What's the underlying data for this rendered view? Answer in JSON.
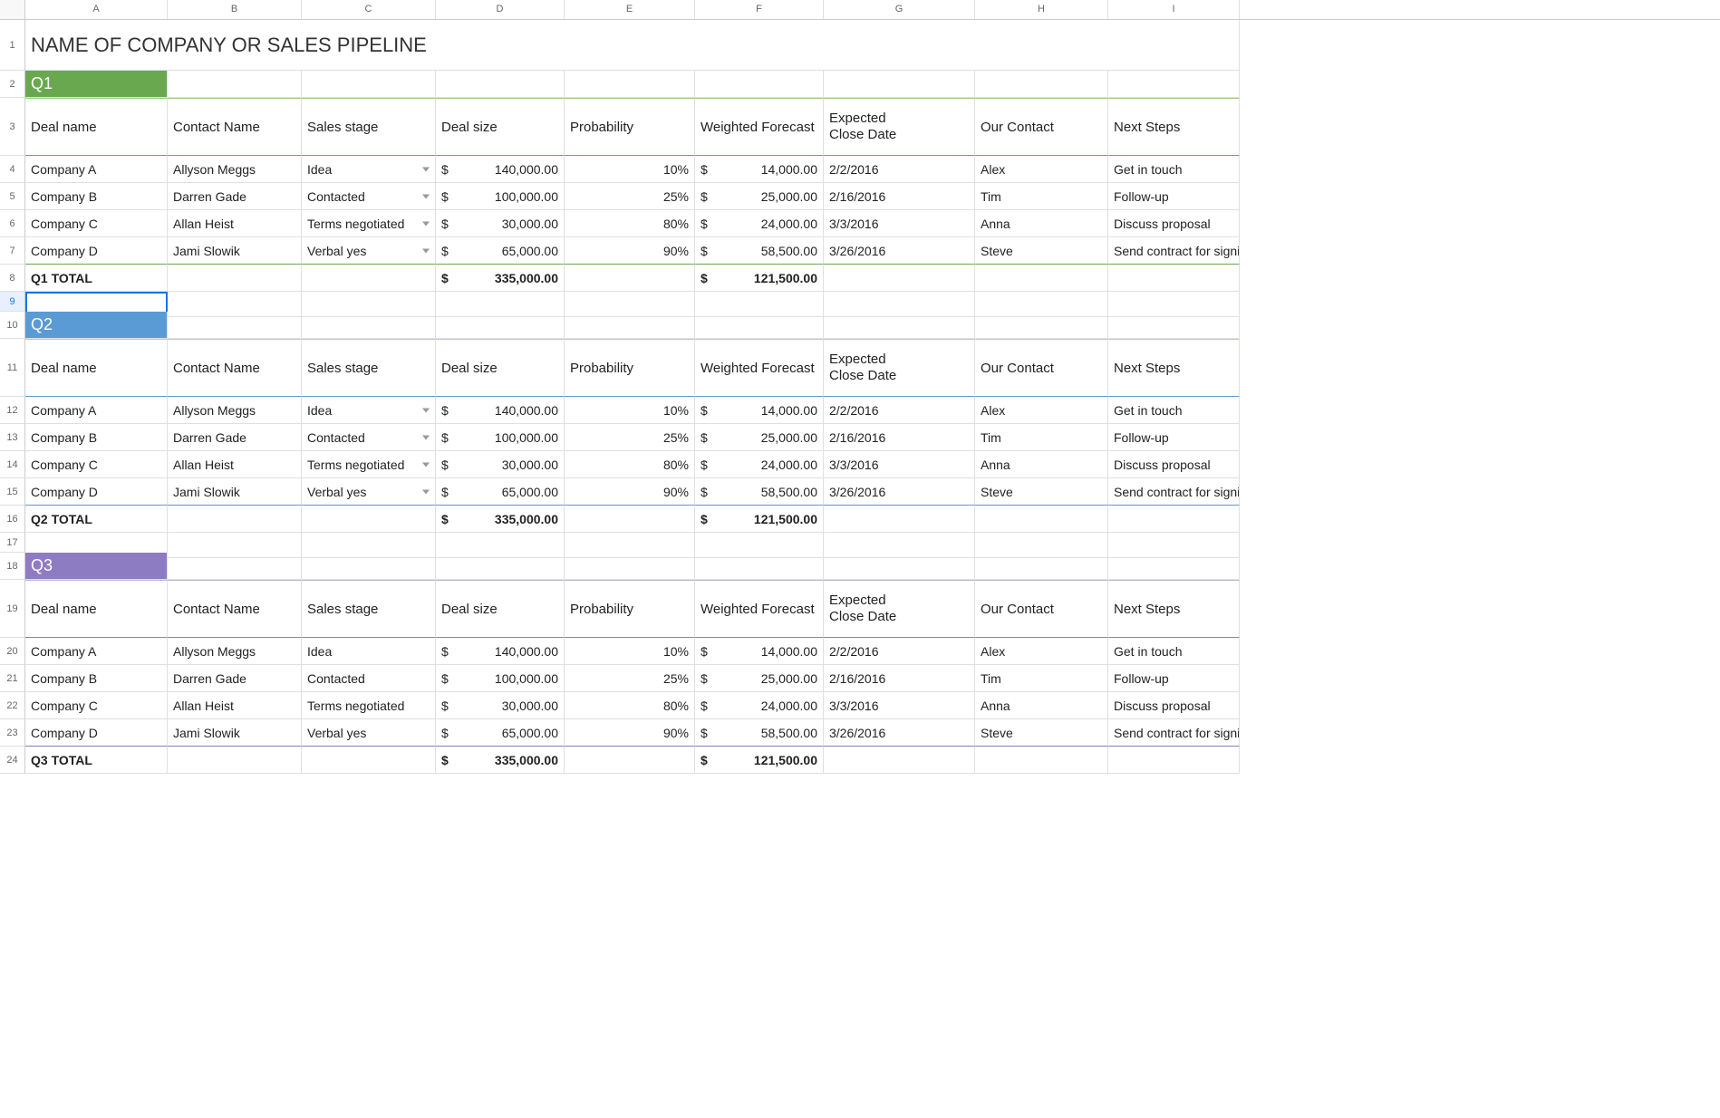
{
  "columns": [
    "A",
    "B",
    "C",
    "D",
    "E",
    "F",
    "G",
    "H",
    "I"
  ],
  "title": "NAME OF COMPANY OR SALES PIPELINE",
  "headers": [
    "Deal name",
    "Contact Name",
    "Sales stage",
    "Deal size",
    "Probability",
    "Weighted Forecast",
    "Expected Close Date",
    "Our Contact",
    "Next Steps"
  ],
  "quarters": [
    {
      "id": "q1",
      "label": "Q1",
      "bandClass": "band-q1",
      "borderClass": "green",
      "hasDropdown": true,
      "totalLabel": "Q1 TOTAL",
      "totalDeal": "335,000.00",
      "totalForecast": "121,500.00",
      "rows": [
        {
          "deal": "Company A",
          "contact": "Allyson Meggs",
          "stage": "Idea",
          "size": "140,000.00",
          "prob": "10%",
          "forecast": "14,000.00",
          "close": "2/2/2016",
          "our": "Alex",
          "next": "Get in touch"
        },
        {
          "deal": "Company B",
          "contact": "Darren Gade",
          "stage": "Contacted",
          "size": "100,000.00",
          "prob": "25%",
          "forecast": "25,000.00",
          "close": "2/16/2016",
          "our": "Tim",
          "next": "Follow-up"
        },
        {
          "deal": "Company C",
          "contact": "Allan Heist",
          "stage": "Terms negotiated",
          "size": "30,000.00",
          "prob": "80%",
          "forecast": "24,000.00",
          "close": "3/3/2016",
          "our": "Anna",
          "next": "Discuss proposal"
        },
        {
          "deal": "Company D",
          "contact": "Jami Slowik",
          "stage": "Verbal yes",
          "size": "65,000.00",
          "prob": "90%",
          "forecast": "58,500.00",
          "close": "3/26/2016",
          "our": "Steve",
          "next": "Send contract for signing"
        }
      ]
    },
    {
      "id": "q2",
      "label": "Q2",
      "bandClass": "band-q2",
      "borderClass": "blue",
      "hasDropdown": true,
      "totalLabel": "Q2 TOTAL",
      "totalDeal": "335,000.00",
      "totalForecast": "121,500.00",
      "rows": [
        {
          "deal": "Company A",
          "contact": "Allyson Meggs",
          "stage": "Idea",
          "size": "140,000.00",
          "prob": "10%",
          "forecast": "14,000.00",
          "close": "2/2/2016",
          "our": "Alex",
          "next": "Get in touch"
        },
        {
          "deal": "Company B",
          "contact": "Darren Gade",
          "stage": "Contacted",
          "size": "100,000.00",
          "prob": "25%",
          "forecast": "25,000.00",
          "close": "2/16/2016",
          "our": "Tim",
          "next": "Follow-up"
        },
        {
          "deal": "Company C",
          "contact": "Allan Heist",
          "stage": "Terms negotiated",
          "size": "30,000.00",
          "prob": "80%",
          "forecast": "24,000.00",
          "close": "3/3/2016",
          "our": "Anna",
          "next": "Discuss proposal"
        },
        {
          "deal": "Company D",
          "contact": "Jami Slowik",
          "stage": "Verbal yes",
          "size": "65,000.00",
          "prob": "90%",
          "forecast": "58,500.00",
          "close": "3/26/2016",
          "our": "Steve",
          "next": "Send contract for signing"
        }
      ]
    },
    {
      "id": "q3",
      "label": "Q3",
      "bandClass": "band-q3",
      "borderClass": "purple",
      "hasDropdown": false,
      "totalLabel": "Q3 TOTAL",
      "totalDeal": "335,000.00",
      "totalForecast": "121,500.00",
      "rows": [
        {
          "deal": "Company A",
          "contact": "Allyson Meggs",
          "stage": "Idea",
          "size": "140,000.00",
          "prob": "10%",
          "forecast": "14,000.00",
          "close": "2/2/2016",
          "our": "Alex",
          "next": "Get in touch"
        },
        {
          "deal": "Company B",
          "contact": "Darren Gade",
          "stage": "Contacted",
          "size": "100,000.00",
          "prob": "25%",
          "forecast": "25,000.00",
          "close": "2/16/2016",
          "our": "Tim",
          "next": "Follow-up"
        },
        {
          "deal": "Company C",
          "contact": "Allan Heist",
          "stage": "Terms negotiated",
          "size": "30,000.00",
          "prob": "80%",
          "forecast": "24,000.00",
          "close": "3/3/2016",
          "our": "Anna",
          "next": "Discuss proposal"
        },
        {
          "deal": "Company D",
          "contact": "Jami Slowik",
          "stage": "Verbal yes",
          "size": "65,000.00",
          "prob": "90%",
          "forecast": "58,500.00",
          "close": "3/26/2016",
          "our": "Steve",
          "next": "Send contract for signing"
        }
      ]
    }
  ],
  "selectedRowHeader": 9,
  "currency": "$"
}
